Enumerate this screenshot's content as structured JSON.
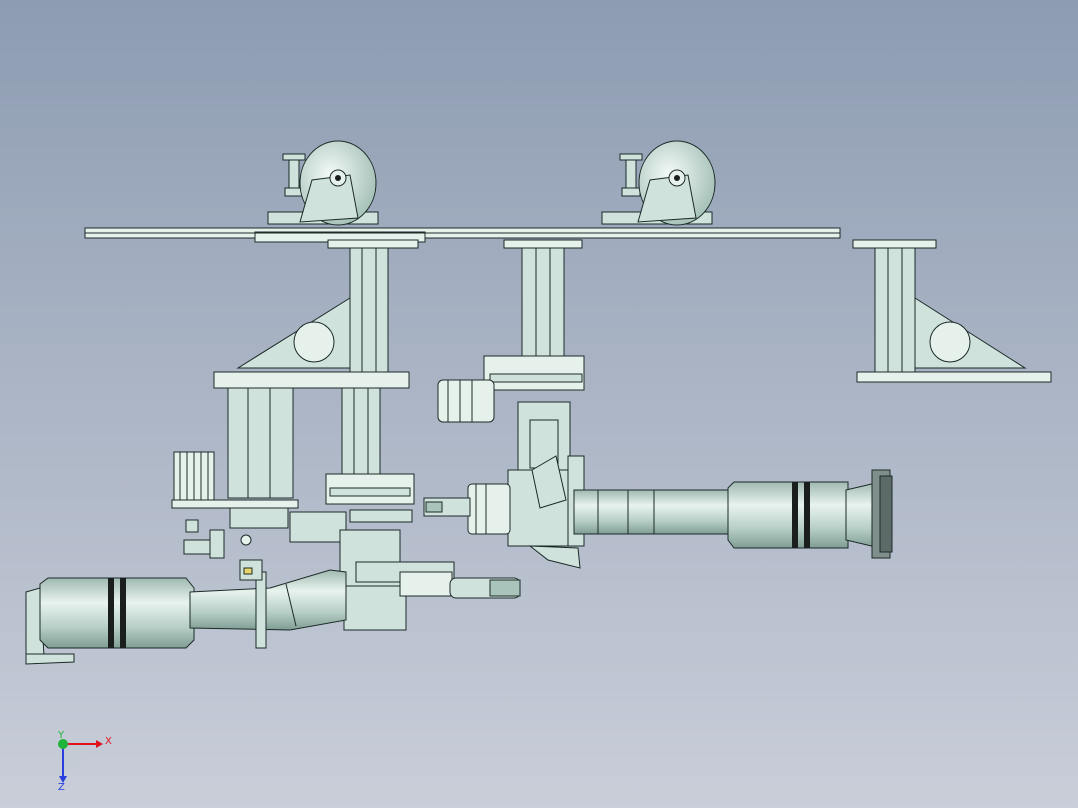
{
  "triad": {
    "x_label": "X",
    "y_label": "Y",
    "z_label": "Z",
    "x_color": "#e0141e",
    "y_color": "#1fb33a",
    "z_color": "#2a3ee0"
  },
  "colors": {
    "part_fill": "#cfe3dc",
    "part_shadow": "#a9c4bb",
    "outline": "#1c2a28"
  }
}
